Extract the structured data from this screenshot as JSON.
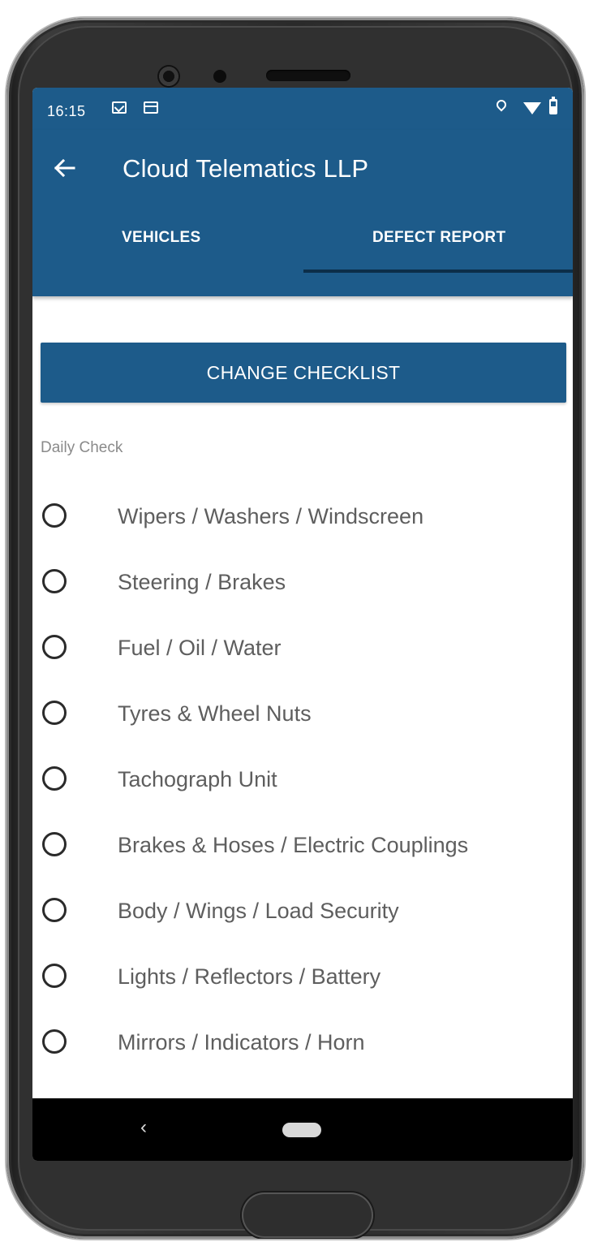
{
  "status_bar": {
    "time": "16:15",
    "icons": [
      "gmail-icon",
      "calendar-icon",
      "location-icon",
      "wifi-icon",
      "battery-icon"
    ]
  },
  "app_bar": {
    "title": "Cloud Telematics LLP",
    "back_icon": "arrow-left-icon"
  },
  "tabs": [
    {
      "label": "VEHICLES",
      "active": false
    },
    {
      "label": "DEFECT REPORT",
      "active": true
    }
  ],
  "main": {
    "change_button_label": "CHANGE CHECKLIST",
    "section_label": "Daily Check",
    "checklist": [
      {
        "label": "Wipers / Washers / Windscreen",
        "checked": false
      },
      {
        "label": "Steering / Brakes",
        "checked": false
      },
      {
        "label": "Fuel / Oil / Water",
        "checked": false
      },
      {
        "label": "Tyres & Wheel Nuts",
        "checked": false
      },
      {
        "label": "Tachograph Unit",
        "checked": false
      },
      {
        "label": "Brakes & Hoses / Electric Couplings",
        "checked": false
      },
      {
        "label": "Body / Wings / Load Security",
        "checked": false
      },
      {
        "label": "Lights / Reflectors / Battery",
        "checked": false
      },
      {
        "label": "Mirrors / Indicators / Horn",
        "checked": false
      }
    ]
  },
  "nav_bar": {
    "back_glyph": "‹",
    "icons": [
      "nav-back-icon",
      "nav-home-pill-icon"
    ]
  },
  "colors": {
    "primary": "#1d5b8a",
    "tab_indicator": "#0c2e49",
    "text_secondary": "#8a8a8a",
    "checklist_text": "#5e5e5e"
  }
}
